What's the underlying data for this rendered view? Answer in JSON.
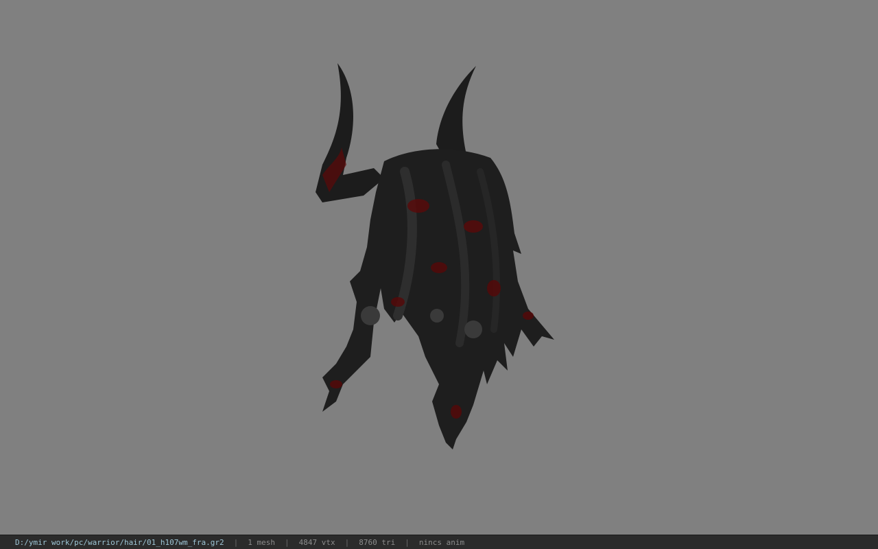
{
  "model": {
    "icon": "horned-hair-mesh-preview",
    "colors": {
      "body": "#1c1c1c",
      "shade": "#2a2a2a",
      "blood": "#6a0a0a"
    }
  },
  "status": {
    "path": "D:/ymir work/pc/warrior/hair/01_h107wm_fra.gr2",
    "separator": "|",
    "mesh": "1 mesh",
    "vtx": "4847 vtx",
    "tri": "8760 tri",
    "anim": "nincs anim"
  }
}
